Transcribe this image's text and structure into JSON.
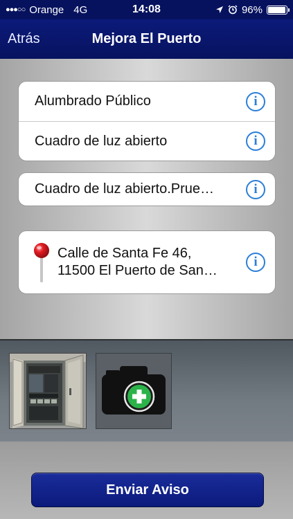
{
  "status_bar": {
    "signal": "●●●○○",
    "carrier": "Orange",
    "network": "4G",
    "time": "14:08",
    "battery_percent": "96%",
    "battery_level": 0.96,
    "icons": [
      "location-arrow-icon",
      "alarm-icon",
      "battery-icon"
    ]
  },
  "nav": {
    "back_label": "Atrás",
    "title": "Mejora El Puerto"
  },
  "form": {
    "category_rows": [
      {
        "label": "Alumbrado Público"
      },
      {
        "label": "Cuadro de luz abierto"
      }
    ],
    "description": "Cuadro de luz abierto.Prue…",
    "address_line1": "Calle de Santa Fe 46,",
    "address_line2": "11500 El Puerto de San…",
    "info_symbol": "i"
  },
  "photos": {
    "thumbnail": "electrical-cabinet-photo",
    "add_icon": "camera-add-icon"
  },
  "actions": {
    "send_label": "Enviar Aviso"
  },
  "colors": {
    "nav_blue": "#07135f",
    "info_blue": "#2b7fd8",
    "add_green": "#2bb34a",
    "pin_red": "#d8141e"
  }
}
